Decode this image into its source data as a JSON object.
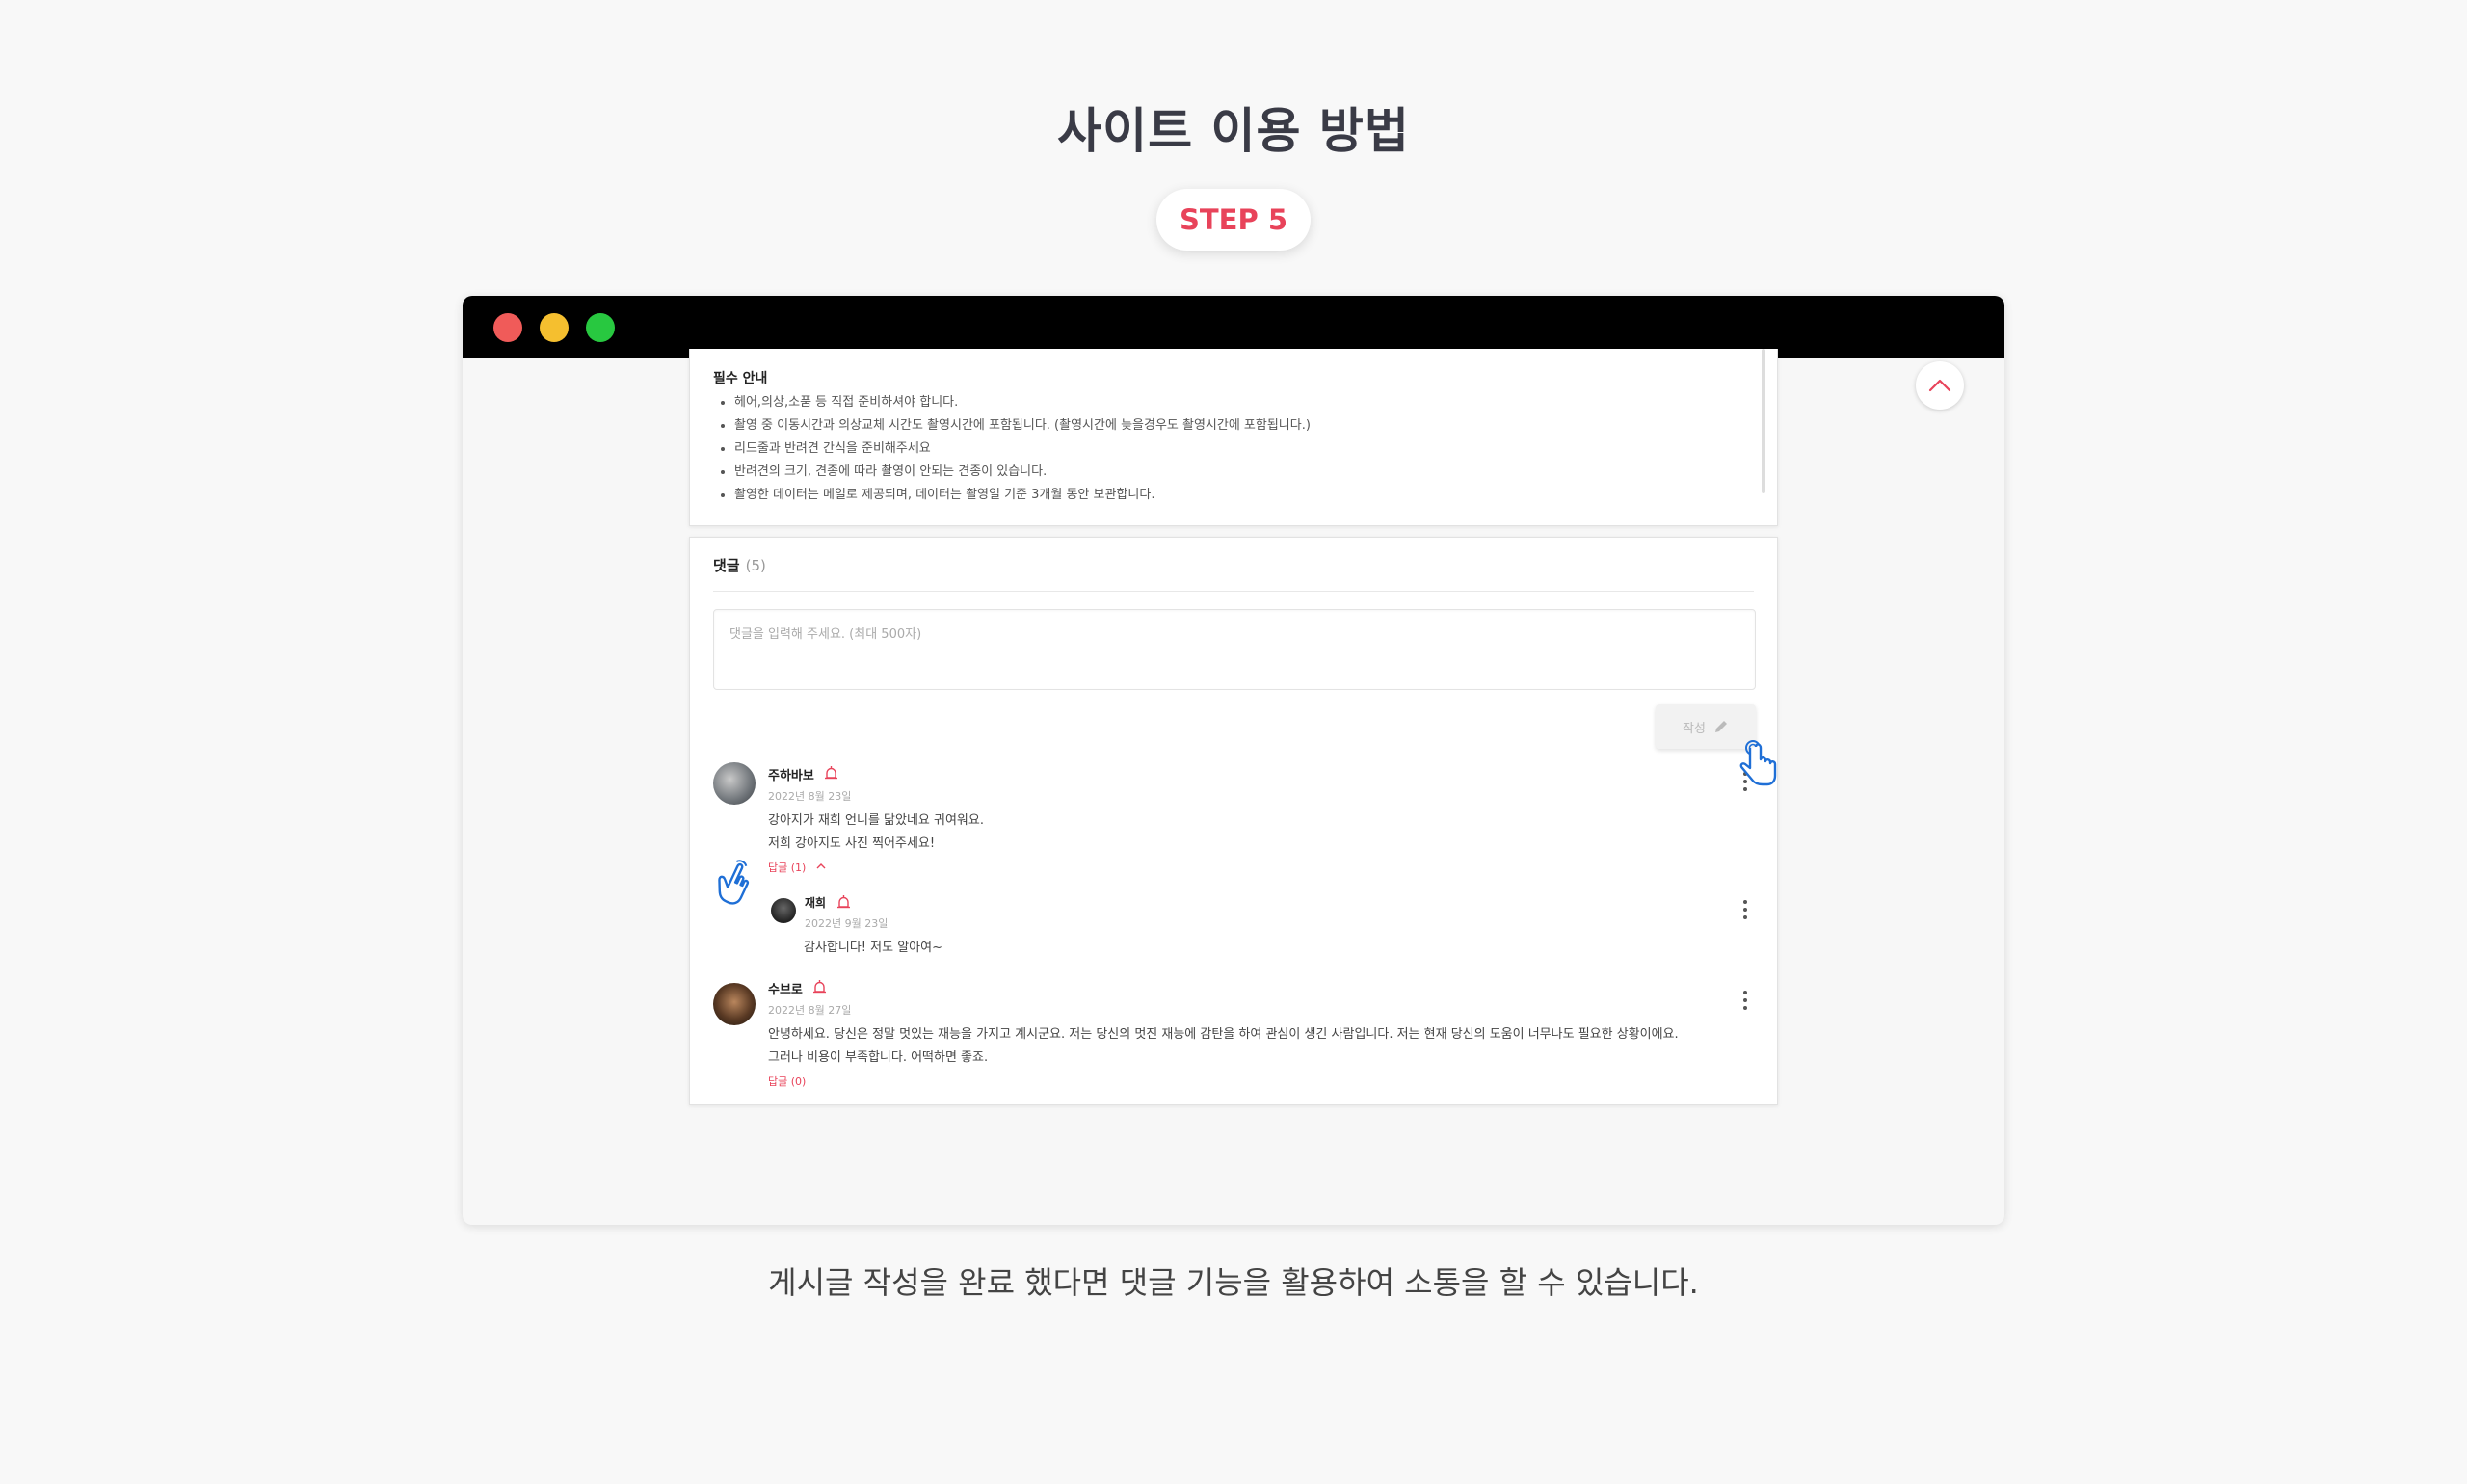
{
  "page": {
    "title": "사이트 이용 방법",
    "step": "STEP 5",
    "caption": "게시글 작성을 완료 했다면 댓글 기능을 활용하여 소통을 할 수 있습니다."
  },
  "notice": {
    "title": "필수 안내",
    "items": [
      "헤어,의상,소품 등 직접 준비하셔야 합니다.",
      "촬영 중 이동시간과 의상교체 시간도 촬영시간에 포함됩니다. (촬영시간에 늦을경우도 촬영시간에 포함됩니다.)",
      "리드줄과 반려견 간식을 준비해주세요",
      "반려견의 크기, 견종에 따라 촬영이 안되는 견종이 있습니다.",
      "촬영한 데이터는 메일로 제공되며, 데이터는 촬영일 기준 3개월 동안 보관합니다."
    ]
  },
  "comments": {
    "header": "댓글",
    "count": "(5)",
    "placeholder": "댓글을 입력해 주세요. (최대 500자)",
    "write_label": "작성",
    "list": [
      {
        "name": "주하바보",
        "date": "2022년 8월 23일",
        "lines": [
          "강아지가 재희 언니를 닮았네요 귀여워요.",
          "저희 강아지도 사진 찍어주세요!"
        ],
        "reply_label": "답글 (1)"
      },
      {
        "name": "재희",
        "date": "2022년 9월 23일",
        "lines": [
          "감사합니다! 저도 알아여~"
        ]
      },
      {
        "name": "수브로",
        "date": "2022년 8월 27일",
        "lines": [
          "안녕하세요. 당신은 정말 멋있는 재능을 가지고 계시군요. 저는 당신의 멋진 재능에 감탄을 하여 관심이 생긴 사람입니다.  저는 현재 당신의 도움이 너무나도 필요한 상황이에요.",
          "그러나 비용이 부족합니다. 어떡하면 좋죠."
        ],
        "reply_label": "답글 (0)"
      }
    ]
  },
  "colors": {
    "accent": "#e8435a",
    "titlebar": "#000000",
    "dot_red": "#f05b59",
    "dot_yellow": "#f5bf2f",
    "dot_green": "#28c840",
    "hand": "#1f6fd6"
  },
  "icons": [
    "scroll-top-icon",
    "pencil-icon",
    "alarm-icon",
    "more-icon",
    "pointing-hand-icon",
    "chevron-up-icon"
  ]
}
